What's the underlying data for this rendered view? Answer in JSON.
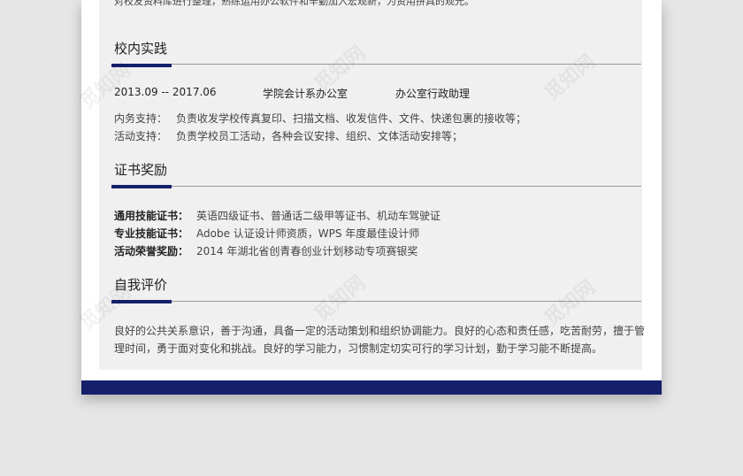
{
  "top_text": "对校友资料库进行整理，熟练运用办公软件和辛勤加入宏观新，为资用拼具的观光。",
  "sections": {
    "practice": {
      "title": "校内实践",
      "period": "2013.09 -- 2017.06",
      "org": "学院会计系办公室",
      "role": "办公室行政助理",
      "items": [
        {
          "label": "内务支持：",
          "text": "负责收发学校传真复印、扫描文档、收发信件、文件、快递包裹的接收等；"
        },
        {
          "label": "活动支持：",
          "text": "负责学校员工活动，各种会议安排、组织、文体活动安排等；"
        }
      ]
    },
    "certs": {
      "title": "证书奖励",
      "items": [
        {
          "label": "通用技能证书：",
          "text": "英语四级证书、普通话二级甲等证书、机动车驾驶证"
        },
        {
          "label": "专业技能证书：",
          "text": "Adobe 认证设计师资质，WPS 年度最佳设计师"
        },
        {
          "label": "活动荣誉奖励：",
          "text": "2014 年湖北省创青春创业计划移动专项赛银奖"
        }
      ]
    },
    "self": {
      "title": "自我评价",
      "line1": "良好的公共关系意识，善于沟通，具备一定的活动策划和组织协调能力。良好的心态和责任感，吃苦耐劳，擅于管",
      "line2": "理时间，勇于面对变化和挑战。良好的学习能力，习惯制定切实可行的学习计划，勤于学习能不断提高。"
    }
  },
  "watermark": "觅知网",
  "colors": {
    "accent": "#15206b",
    "background": "#e6e6e6",
    "panel": "#f0f0f0"
  }
}
